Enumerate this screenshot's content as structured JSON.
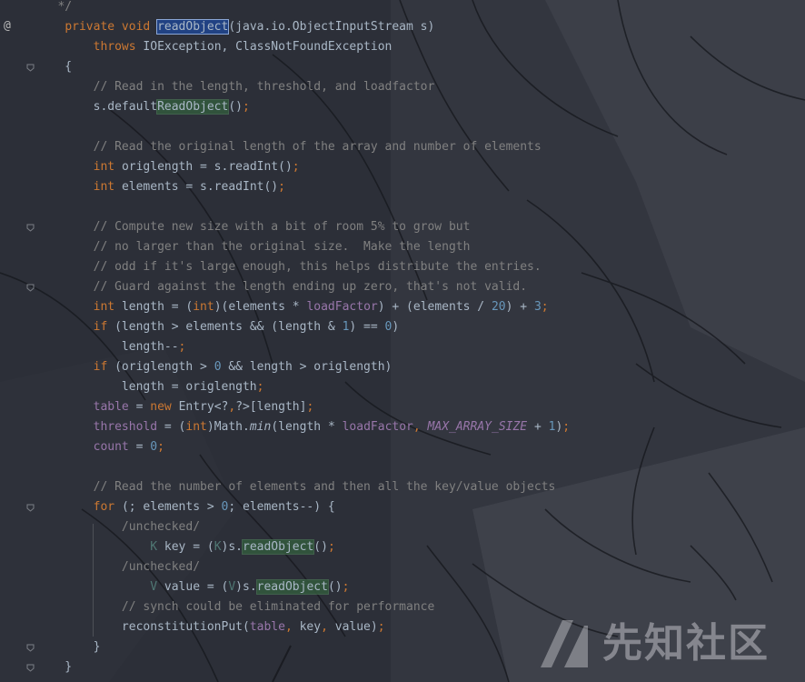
{
  "editor": {
    "theme_colors": {
      "background": "#2b2e36",
      "keyword": "#cc7832",
      "comment": "#808080",
      "number": "#6897bb",
      "field": "#9876aa",
      "text": "#a9b7c6",
      "selection": "#214283",
      "usage_highlight": "#32593d"
    },
    "gutter": {
      "override_marker": "@",
      "fold_icon": "fold-marker-icon"
    },
    "lines": [
      [
        {
          "t": "   */",
          "c": "cm"
        }
      ],
      [
        {
          "t": "    "
        },
        {
          "t": "private void ",
          "c": "kw"
        },
        {
          "t": "readObject",
          "c": "sel"
        },
        {
          "t": "(java.io.ObjectInputStream s)"
        }
      ],
      [
        {
          "t": "        "
        },
        {
          "t": "throws ",
          "c": "kw"
        },
        {
          "t": "IOException, ClassNotFoundException"
        }
      ],
      [
        {
          "t": "    {"
        }
      ],
      [
        {
          "t": "        "
        },
        {
          "t": "// Read in the length, threshold, and loadfactor",
          "c": "cm"
        }
      ],
      [
        {
          "t": "        s.default"
        },
        {
          "t": "ReadObject",
          "c": "hl"
        },
        {
          "t": "()"
        },
        {
          "t": ";",
          "c": "kw"
        }
      ],
      [
        {
          "t": ""
        }
      ],
      [
        {
          "t": "        "
        },
        {
          "t": "// Read the original length of the array and number of elements",
          "c": "cm"
        }
      ],
      [
        {
          "t": "        "
        },
        {
          "t": "int ",
          "c": "kw"
        },
        {
          "t": "origlength = s.readInt()"
        },
        {
          "t": ";",
          "c": "kw"
        }
      ],
      [
        {
          "t": "        "
        },
        {
          "t": "int ",
          "c": "kw"
        },
        {
          "t": "elements = s.readInt()"
        },
        {
          "t": ";",
          "c": "kw"
        }
      ],
      [
        {
          "t": ""
        }
      ],
      [
        {
          "t": "        "
        },
        {
          "t": "// Compute new size with a bit of room 5% to grow but",
          "c": "cm"
        }
      ],
      [
        {
          "t": "        "
        },
        {
          "t": "// no larger than the original size.  Make the length",
          "c": "cm"
        }
      ],
      [
        {
          "t": "        "
        },
        {
          "t": "// odd if it's large enough, this helps distribute the entries.",
          "c": "cm"
        }
      ],
      [
        {
          "t": "        "
        },
        {
          "t": "// Guard against the length ending up zero, that's not valid.",
          "c": "cm"
        }
      ],
      [
        {
          "t": "        "
        },
        {
          "t": "int ",
          "c": "kw"
        },
        {
          "t": "length = ("
        },
        {
          "t": "int",
          "c": "kw"
        },
        {
          "t": ")(elements * "
        },
        {
          "t": "loadFactor",
          "c": "fld"
        },
        {
          "t": ") + (elements / "
        },
        {
          "t": "20",
          "c": "num"
        },
        {
          "t": ") + "
        },
        {
          "t": "3",
          "c": "num"
        },
        {
          "t": ";",
          "c": "kw"
        }
      ],
      [
        {
          "t": "        "
        },
        {
          "t": "if ",
          "c": "kw"
        },
        {
          "t": "(length > elements && (length & "
        },
        {
          "t": "1",
          "c": "num"
        },
        {
          "t": ") == "
        },
        {
          "t": "0",
          "c": "num"
        },
        {
          "t": ")"
        }
      ],
      [
        {
          "t": "            length--"
        },
        {
          "t": ";",
          "c": "kw"
        }
      ],
      [
        {
          "t": "        "
        },
        {
          "t": "if ",
          "c": "kw"
        },
        {
          "t": "(origlength > "
        },
        {
          "t": "0 ",
          "c": "num"
        },
        {
          "t": "&& length > origlength)"
        }
      ],
      [
        {
          "t": "            length = origlength"
        },
        {
          "t": ";",
          "c": "kw"
        }
      ],
      [
        {
          "t": "        "
        },
        {
          "t": "table",
          "c": "fld"
        },
        {
          "t": " = "
        },
        {
          "t": "new ",
          "c": "kw"
        },
        {
          "t": "Entry<?"
        },
        {
          "t": ",",
          "c": "kw"
        },
        {
          "t": "?>[length]"
        },
        {
          "t": ";",
          "c": "kw"
        }
      ],
      [
        {
          "t": "        "
        },
        {
          "t": "threshold",
          "c": "fld"
        },
        {
          "t": " = ("
        },
        {
          "t": "int",
          "c": "kw"
        },
        {
          "t": ")Math."
        },
        {
          "t": "min",
          "c": "ital"
        },
        {
          "t": "(length * "
        },
        {
          "t": "loadFactor",
          "c": "fld"
        },
        {
          "t": ", ",
          "c": "kw"
        },
        {
          "t": "MAX_ARRAY_SIZE",
          "c": "fldi"
        },
        {
          "t": " + "
        },
        {
          "t": "1",
          "c": "num"
        },
        {
          "t": ")"
        },
        {
          "t": ";",
          "c": "kw"
        }
      ],
      [
        {
          "t": "        "
        },
        {
          "t": "count",
          "c": "fld"
        },
        {
          "t": " = "
        },
        {
          "t": "0",
          "c": "num"
        },
        {
          "t": ";",
          "c": "kw"
        }
      ],
      [
        {
          "t": ""
        }
      ],
      [
        {
          "t": "        "
        },
        {
          "t": "// Read the number of elements and then all the key/value objects",
          "c": "cm"
        }
      ],
      [
        {
          "t": "        "
        },
        {
          "t": "for ",
          "c": "kw"
        },
        {
          "t": "(; elements > "
        },
        {
          "t": "0",
          "c": "num"
        },
        {
          "t": "; elements--) {"
        }
      ],
      [
        {
          "t": "            "
        },
        {
          "t": "/unchecked/",
          "c": "cm"
        }
      ],
      [
        {
          "t": "                "
        },
        {
          "t": "K",
          "c": "tp"
        },
        {
          "t": " key = ("
        },
        {
          "t": "K",
          "c": "tp"
        },
        {
          "t": ")s."
        },
        {
          "t": "readObject",
          "c": "hl"
        },
        {
          "t": "()"
        },
        {
          "t": ";",
          "c": "kw"
        }
      ],
      [
        {
          "t": "            "
        },
        {
          "t": "/unchecked/",
          "c": "cm"
        }
      ],
      [
        {
          "t": "                "
        },
        {
          "t": "V",
          "c": "tp"
        },
        {
          "t": " value = ("
        },
        {
          "t": "V",
          "c": "tp"
        },
        {
          "t": ")s."
        },
        {
          "t": "readObject",
          "c": "hl"
        },
        {
          "t": "()"
        },
        {
          "t": ";",
          "c": "kw"
        }
      ],
      [
        {
          "t": "            "
        },
        {
          "t": "// synch could be eliminated for performance",
          "c": "cm"
        }
      ],
      [
        {
          "t": "            reconstitutionPut("
        },
        {
          "t": "table",
          "c": "fld"
        },
        {
          "t": ", ",
          "c": "kw"
        },
        {
          "t": "key"
        },
        {
          "t": ", ",
          "c": "kw"
        },
        {
          "t": "value)"
        },
        {
          "t": ";",
          "c": "kw"
        }
      ],
      [
        {
          "t": "        }"
        }
      ],
      [
        {
          "t": "    }"
        }
      ]
    ]
  },
  "watermark": {
    "text": "先知社区",
    "icon": "xianzhi-logo-icon"
  }
}
